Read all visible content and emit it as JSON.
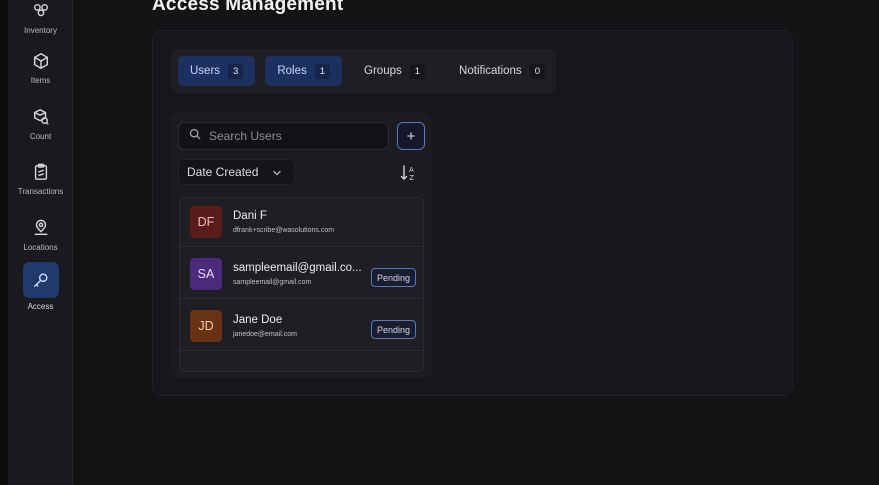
{
  "sidebar": {
    "items": [
      {
        "label": "Inventory",
        "icon": "inventory-icon",
        "active": false
      },
      {
        "label": "Items",
        "icon": "cube-icon",
        "active": false
      },
      {
        "label": "Count",
        "icon": "count-box-icon",
        "active": false
      },
      {
        "label": "Transactions",
        "icon": "clipboard-icon",
        "active": false
      },
      {
        "label": "Locations",
        "icon": "map-pin-icon",
        "active": false
      },
      {
        "label": "Access",
        "icon": "key-icon",
        "active": true
      }
    ]
  },
  "page": {
    "title": "Access Management"
  },
  "tabs": [
    {
      "label": "Users",
      "count": "3",
      "active": true
    },
    {
      "label": "Roles",
      "count": "1",
      "active": true
    },
    {
      "label": "Groups",
      "count": "1",
      "active": false
    },
    {
      "label": "Notifications",
      "count": "0",
      "active": false
    }
  ],
  "search": {
    "placeholder": "Search Users",
    "value": ""
  },
  "add_button": {
    "label": "+"
  },
  "sort": {
    "selected": "Date Created",
    "direction_icon": "sort-alpha-icon"
  },
  "users": [
    {
      "initials": "DF",
      "name": "Dani F",
      "email": "dfrank+scribe@wasolutions.com",
      "status": "",
      "color": "#5a1b1b",
      "text_color": "#f0b9b9"
    },
    {
      "initials": "SA",
      "name": "sampleemail@gmail.co...",
      "email": "sampleemail@gmail.com",
      "status": "Pending",
      "color": "#4a2a7a",
      "text_color": "#e6d6ff"
    },
    {
      "initials": "JD",
      "name": "Jane Doe",
      "email": "janedoe@email.com",
      "status": "Pending",
      "color": "#6a3215",
      "text_color": "#f5cfae"
    }
  ],
  "colors": {
    "accent": "#5677c2",
    "active_tab": "#1c3160",
    "background": "#141417"
  }
}
